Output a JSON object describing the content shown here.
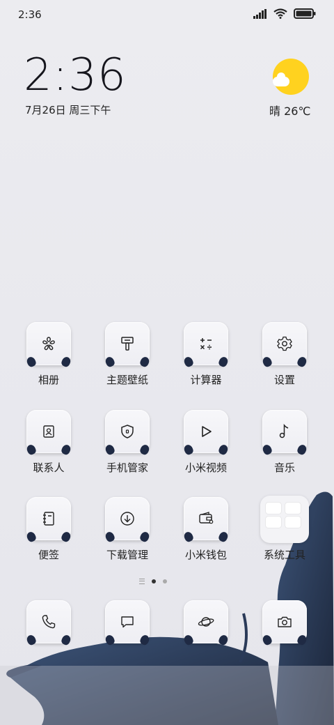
{
  "status_bar": {
    "time": "2:36"
  },
  "clock_widget": {
    "time": "2:36",
    "date": "7月26日 周三下午"
  },
  "weather": {
    "text": "晴 26℃",
    "icon": "sunny-cloud-icon"
  },
  "apps": [
    {
      "label": "相册",
      "icon": "flower-icon"
    },
    {
      "label": "主题壁纸",
      "icon": "paintbrush-icon"
    },
    {
      "label": "计算器",
      "icon": "calculator-icon"
    },
    {
      "label": "设置",
      "icon": "gear-icon"
    },
    {
      "label": "联系人",
      "icon": "contact-card-icon"
    },
    {
      "label": "手机管家",
      "icon": "shield-icon"
    },
    {
      "label": "小米视频",
      "icon": "play-icon"
    },
    {
      "label": "音乐",
      "icon": "music-note-icon"
    },
    {
      "label": "便签",
      "icon": "notepad-icon"
    },
    {
      "label": "下载管理",
      "icon": "download-icon"
    },
    {
      "label": "小米钱包",
      "icon": "wallet-icon"
    },
    {
      "label": "系统工具",
      "icon": "folder-icon"
    }
  ],
  "dock": [
    {
      "name": "phone",
      "icon": "phone-icon"
    },
    {
      "name": "messages",
      "icon": "message-icon"
    },
    {
      "name": "browser",
      "icon": "planet-icon"
    },
    {
      "name": "camera",
      "icon": "camera-icon"
    }
  ],
  "page_indicator": {
    "pages": 2,
    "current": 1
  },
  "colors": {
    "accent_sun": "#ffd21f",
    "horn": "#1f2a44",
    "background": "#ebebf0"
  }
}
